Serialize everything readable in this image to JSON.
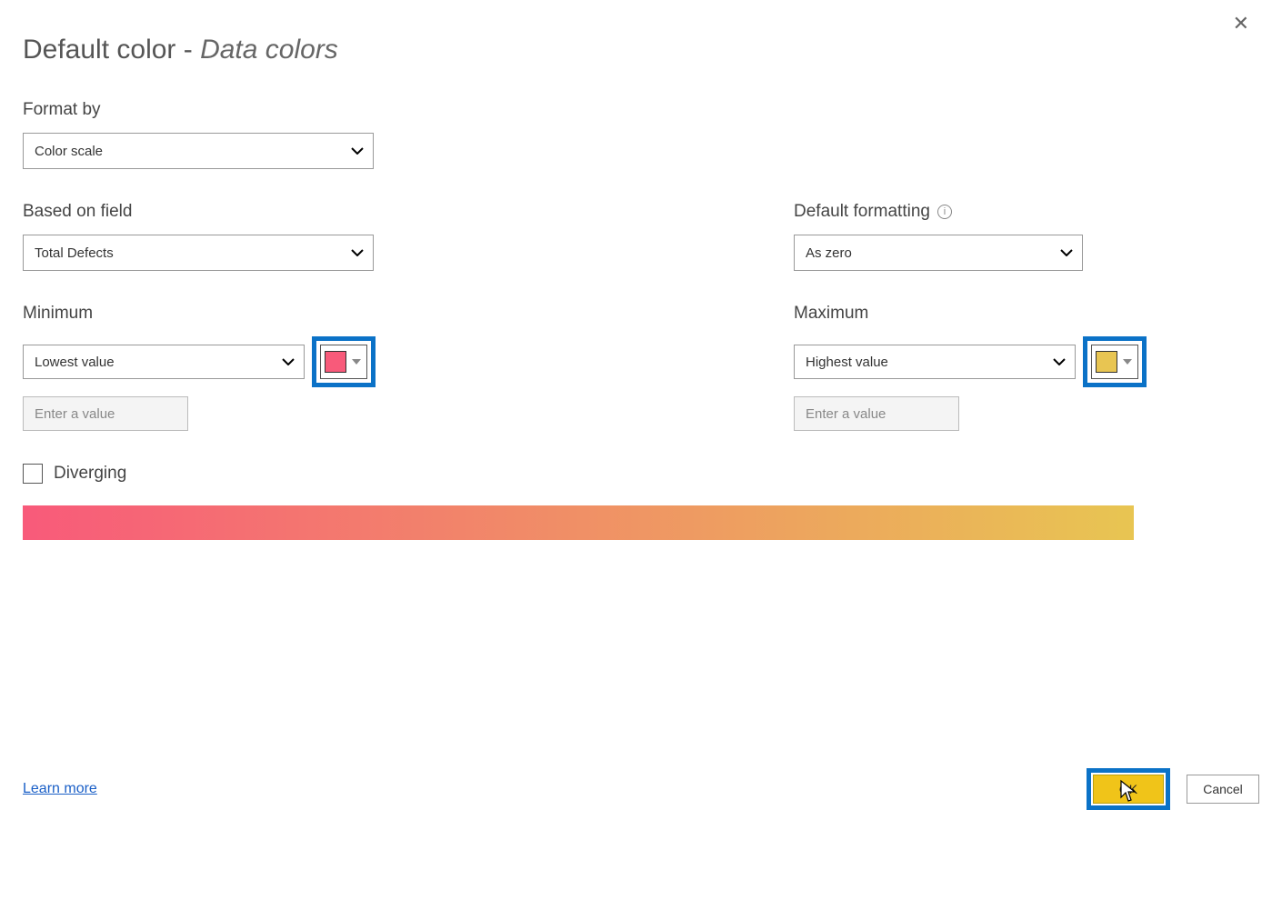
{
  "title": {
    "main": "Default color - ",
    "sub": "Data colors"
  },
  "format_by": {
    "label": "Format by",
    "value": "Color scale"
  },
  "based_on_field": {
    "label": "Based on field",
    "value": "Total Defects"
  },
  "default_formatting": {
    "label": "Default formatting",
    "value": "As zero"
  },
  "minimum": {
    "label": "Minimum",
    "value": "Lowest value",
    "placeholder": "Enter a value",
    "color": "#f85a7a"
  },
  "maximum": {
    "label": "Maximum",
    "value": "Highest value",
    "placeholder": "Enter a value",
    "color": "#e8c552"
  },
  "diverging_label": "Diverging",
  "learn_more": "Learn more",
  "buttons": {
    "ok": "OK",
    "cancel": "Cancel"
  },
  "gradient": {
    "from": "#f85a7a",
    "to": "#e8c552"
  }
}
